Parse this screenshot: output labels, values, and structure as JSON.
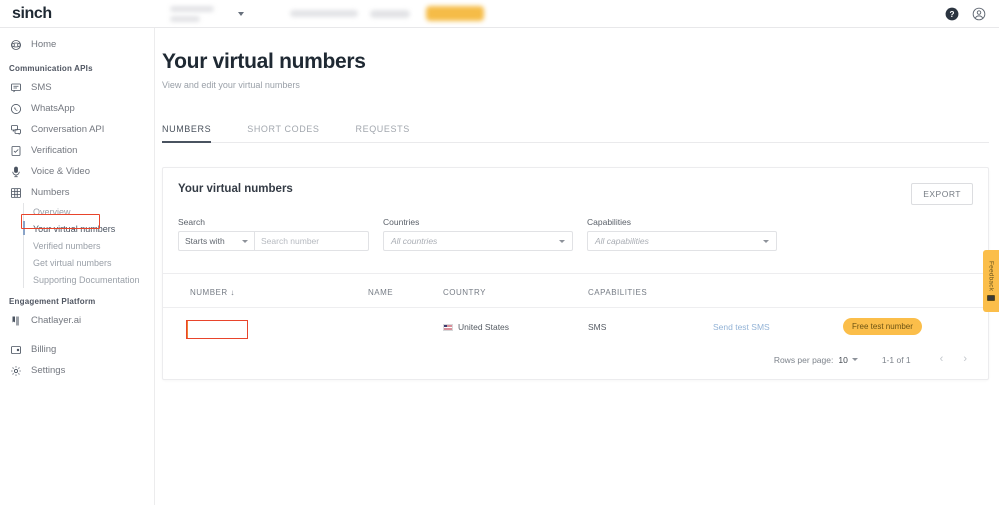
{
  "topbar": {
    "logo": "sinch",
    "help_icon": "help-circle-icon",
    "account_icon": "user-account-icon"
  },
  "sidebar": {
    "home": {
      "label": "Home",
      "icon": "home-icon"
    },
    "sections": [
      {
        "title": "Communication APIs",
        "items": [
          {
            "label": "SMS",
            "icon": "sms-icon"
          },
          {
            "label": "WhatsApp",
            "icon": "whatsapp-icon"
          },
          {
            "label": "Conversation API",
            "icon": "conversation-icon"
          },
          {
            "label": "Verification",
            "icon": "verification-icon"
          },
          {
            "label": "Voice & Video",
            "icon": "microphone-icon"
          },
          {
            "label": "Numbers",
            "icon": "numbers-grid-icon"
          }
        ]
      }
    ],
    "subnav": [
      {
        "label": "Overview",
        "active": false
      },
      {
        "label": "Your virtual numbers",
        "active": true
      },
      {
        "label": "Verified numbers",
        "active": false
      },
      {
        "label": "Get virtual numbers",
        "active": false
      },
      {
        "label": "Supporting Documentation",
        "active": false
      }
    ],
    "engagement_title": "Engagement Platform",
    "engagement_items": [
      {
        "label": "Chatlayer.ai",
        "icon": "chatlayer-icon"
      }
    ],
    "footer_items": [
      {
        "label": "Billing",
        "icon": "billing-wallet-icon"
      },
      {
        "label": "Settings",
        "icon": "gear-icon"
      }
    ]
  },
  "page": {
    "title": "Your virtual numbers",
    "subtitle": "View and edit your virtual numbers",
    "tabs": [
      {
        "label": "NUMBERS",
        "active": true
      },
      {
        "label": "SHORT CODES",
        "active": false
      },
      {
        "label": "REQUESTS",
        "active": false
      }
    ]
  },
  "card": {
    "title": "Your virtual numbers",
    "export_label": "EXPORT",
    "filters": {
      "search_label": "Search",
      "search_mode_value": "Starts with",
      "search_placeholder": "Search number",
      "countries_label": "Countries",
      "countries_value": "All countries",
      "capabilities_label": "Capabilities",
      "capabilities_value": "All capabilities"
    }
  },
  "table": {
    "columns": [
      "NUMBER",
      "NAME",
      "COUNTRY",
      "CAPABILITIES",
      "",
      ""
    ],
    "sort_column": "NUMBER",
    "sort_indicator": "↓",
    "rows": [
      {
        "number": "",
        "name": "",
        "country": "United States",
        "country_flag": "us-flag-icon",
        "capabilities": "SMS",
        "action_label": "Send test SMS",
        "badge": "Free test number"
      }
    ]
  },
  "pagination": {
    "rows_per_page_label": "Rows per page:",
    "rows_per_page_value": "10",
    "range_label": "1-1 of 1",
    "prev_icon": "chevron-left-icon",
    "next_icon": "chevron-right-icon"
  },
  "feedback": {
    "label": "Feedback",
    "icon": "feedback-icon"
  },
  "colors": {
    "accent_amber": "#fbbe4a",
    "highlight_red": "#e8442b",
    "link_blue": "#93b3d6",
    "text_dark": "#1f2933"
  }
}
